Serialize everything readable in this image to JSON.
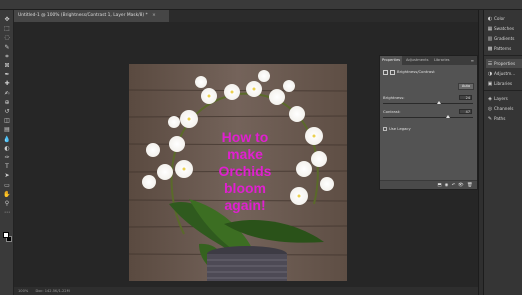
{
  "document": {
    "tab_title": "Untitled-1 @ 100% (Brightness/Contrast 1, Layer Mask/8) *",
    "tab_close": "×"
  },
  "toolbar": {
    "tools": [
      "move-tool",
      "marquee-tool",
      "lasso-tool",
      "quick-select-tool",
      "crop-tool",
      "frame-tool",
      "eyedropper-tool",
      "healing-brush-tool",
      "brush-tool",
      "clone-stamp-tool",
      "history-brush-tool",
      "eraser-tool",
      "gradient-tool",
      "blur-tool",
      "dodge-tool",
      "pen-tool",
      "type-tool",
      "path-select-tool",
      "rectangle-tool",
      "hand-tool",
      "zoom-tool",
      "more-tools"
    ],
    "glyphs": [
      "✥",
      "⬚",
      "◌",
      "✎",
      "⌗",
      "⊠",
      "✒",
      "✚",
      "✍",
      "⊕",
      "↺",
      "◫",
      "▤",
      "💧",
      "◐",
      "✑",
      "T",
      "➤",
      "▭",
      "✋",
      "⚲",
      "⋯"
    ],
    "foreground_color": "#ffffff",
    "background_color": "#000000"
  },
  "artwork": {
    "text_lines": [
      "How to",
      "make",
      "Orchids",
      "bloom",
      "again!"
    ],
    "text_color": "#e020d0",
    "wood_color": "#6b5a4e"
  },
  "status": {
    "zoom": "100%",
    "doc_info": "Doc: 142.5K/1.22M"
  },
  "properties": {
    "tabs": [
      "Properties",
      "Adjustments",
      "Libraries"
    ],
    "menu_glyph": "≡",
    "adjustment_name": "Brightness/Contrast",
    "auto_label": "Auto",
    "brightness_label": "Brightness:",
    "brightness_value": "24",
    "contrast_label": "Contrast:",
    "contrast_value": "47",
    "legacy_label": "Use Legacy",
    "footer_icons": [
      "clip-icon",
      "visibility-eye-icon",
      "reset-icon",
      "toggle-visibility-icon",
      "trash-icon"
    ],
    "footer_glyphs": [
      "⬒",
      "◉",
      "↶",
      "👁",
      "🗑"
    ]
  },
  "dock": {
    "items": [
      {
        "label": "Color",
        "icon": "color-icon",
        "glyph": "◐"
      },
      {
        "label": "Swatches",
        "icon": "swatches-icon",
        "glyph": "▦"
      },
      {
        "label": "Gradients",
        "icon": "gradients-icon",
        "glyph": "▥"
      },
      {
        "label": "Patterns",
        "icon": "patterns-icon",
        "glyph": "▩"
      },
      {
        "label": "Properties",
        "icon": "properties-icon",
        "glyph": "☰"
      },
      {
        "label": "Adjustm...",
        "icon": "adjustments-icon",
        "glyph": "◑"
      },
      {
        "label": "Libraries",
        "icon": "libraries-icon",
        "glyph": "▣"
      },
      {
        "label": "Layers",
        "icon": "layers-icon",
        "glyph": "◈"
      },
      {
        "label": "Channels",
        "icon": "channels-icon",
        "glyph": "◎"
      },
      {
        "label": "Paths",
        "icon": "paths-icon",
        "glyph": "✎"
      }
    ]
  }
}
